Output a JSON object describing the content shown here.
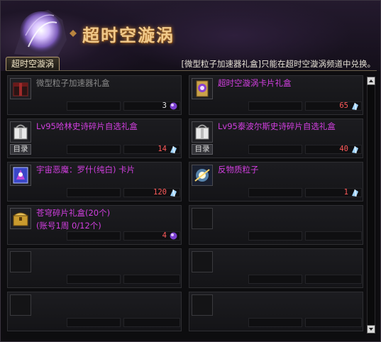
{
  "header": {
    "title": "超时空漩涡",
    "tab_label": "超时空漩涡",
    "notice": "[微型粒子加速器礼盒]只能在超时空漩涡频道中兑换。"
  },
  "colors": {
    "item_name": "#d23fe0",
    "disabled_name": "#8a8a8a",
    "quantity": "#ff5a5a",
    "title": "#f0c98a"
  },
  "items": [
    {
      "name": "微型粒子加速器礼盒",
      "sub": "",
      "qty": "3",
      "tag": "",
      "icon": "black-red-box-icon",
      "currency": "purple-orb-icon"
    },
    {
      "name": "超时空漩涡卡片礼盒",
      "sub": "",
      "qty": "65",
      "tag": "",
      "icon": "golden-card-box-icon",
      "currency": "crystal-shard-icon"
    },
    {
      "name": "Lv95哈林史诗碎片自选礼盒",
      "sub": "",
      "qty": "14",
      "tag": "目录",
      "icon": "white-gift-box-icon",
      "currency": "crystal-shard-icon"
    },
    {
      "name": "Lv95泰波尔斯史诗碎片自选礼盒",
      "sub": "",
      "qty": "40",
      "tag": "目录",
      "icon": "white-gift-box-icon",
      "currency": "crystal-shard-icon"
    },
    {
      "name": "宇宙恶魔：罗什(纯白) 卡片",
      "sub": "",
      "qty": "120",
      "tag": "",
      "icon": "blue-card-icon",
      "currency": "crystal-shard-icon"
    },
    {
      "name": "反物质粒子",
      "sub": "",
      "qty": "1",
      "tag": "",
      "icon": "light-particle-icon",
      "currency": "crystal-shard-icon"
    },
    {
      "name": "苍穹碎片礼盒(20个)",
      "sub": "(账号1周 0/12个)",
      "qty": "4",
      "tag": "",
      "icon": "gold-chest-icon",
      "currency": "purple-orb-icon"
    }
  ]
}
